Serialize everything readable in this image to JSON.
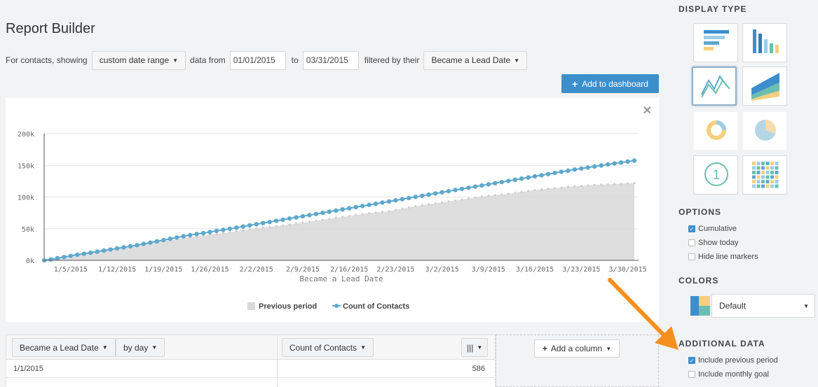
{
  "page_title": "Report Builder",
  "filter": {
    "prefix": "For contacts, showing",
    "range_label": "custom date range",
    "data_from": "data from",
    "start_date": "01/01/2015",
    "to": "to",
    "end_date": "03/31/2015",
    "filtered_by": "filtered by their",
    "property_label": "Became a Lead Date"
  },
  "add_dashboard_label": "Add to dashboard",
  "chart_data": {
    "type": "area",
    "xlabel": "Became a Lead Date",
    "ylim": [
      0,
      200000
    ],
    "y_ticks": [
      "0k",
      "50k",
      "100k",
      "150k",
      "200k"
    ],
    "x_ticks": [
      "1/5/2015",
      "1/12/2015",
      "1/19/2015",
      "1/26/2015",
      "2/2/2015",
      "2/9/2015",
      "2/16/2015",
      "2/23/2015",
      "3/2/2015",
      "3/9/2015",
      "3/16/2015",
      "3/23/2015",
      "3/30/2015"
    ],
    "x_range": [
      "2015-01-01",
      "2015-03-31"
    ],
    "legend": [
      "Previous period",
      "Count of Contacts"
    ],
    "legend_placement": "bottom-center",
    "grid": true,
    "colors": {
      "previous": "#d8d8d8",
      "count": "#5ea8cc"
    },
    "series": [
      {
        "name": "Count of Contacts",
        "values": [
          0,
          1500,
          3500,
          5200,
          7000,
          8800,
          10400,
          12000,
          13700,
          15400,
          17100,
          18800,
          20500,
          22300,
          24000,
          26000,
          28000,
          30000,
          32000,
          34000,
          36000,
          38000,
          39800,
          41500,
          43000,
          44800,
          46600,
          48200,
          49800,
          51600,
          53400,
          55200,
          57000,
          58800,
          60600,
          62400,
          64200,
          66000,
          67800,
          69600,
          71400,
          73200,
          75000,
          76800,
          78600,
          80400,
          82200,
          84000,
          85800,
          87600,
          89400,
          91200,
          93000,
          94800,
          96600,
          98400,
          100200,
          102000,
          103800,
          105600,
          107400,
          109200,
          111000,
          112800,
          114600,
          116400,
          118200,
          120000,
          121800,
          123600,
          125400,
          127200,
          129000,
          130800,
          132600,
          134400,
          136200,
          138000,
          139800,
          141600,
          143400,
          145000,
          146600,
          148200,
          149800,
          151400,
          153000,
          154500,
          156000,
          157500
        ]
      },
      {
        "name": "Previous period",
        "values": [
          0,
          2000,
          4300,
          6400,
          8300,
          10000,
          11800,
          13500,
          15200,
          16800,
          18400,
          20000,
          21500,
          23000,
          24500,
          26000,
          27500,
          29000,
          30500,
          32000,
          33500,
          35000,
          36500,
          38000,
          39500,
          41000,
          42000,
          43000,
          44500,
          46000,
          47500,
          49000,
          50500,
          52000,
          53000,
          54000,
          55000,
          56500,
          58000,
          59500,
          61000,
          62500,
          64000,
          65500,
          67000,
          68500,
          70000,
          71500,
          73000,
          74500,
          75500,
          76500,
          77500,
          79500,
          81500,
          83500,
          85500,
          87000,
          88500,
          90000,
          91500,
          93000,
          94500,
          96000,
          97500,
          99000,
          100500,
          102000,
          103000,
          104000,
          105000,
          106500,
          108000,
          109500,
          111000,
          112000,
          113000,
          114000,
          115000,
          116000,
          116800,
          117500,
          118200,
          118900,
          119500,
          120000,
          120500,
          121000,
          121500,
          122000
        ]
      }
    ]
  },
  "table": {
    "group_label": "Became a Lead Date",
    "interval_label": "by day",
    "metric_label": "Count of Contacts",
    "columns_icon": "|||",
    "add_column_label": "Add a column",
    "rows": [
      {
        "date": "1/1/2015",
        "value": "586"
      }
    ]
  },
  "sidebar": {
    "display_type_title": "DISPLAY TYPE",
    "chart_types": [
      "horizontal-bar-chart",
      "vertical-bar-chart",
      "line-chart",
      "stacked-area-chart",
      "donut-chart",
      "pie-chart",
      "single-number",
      "table-chart"
    ],
    "selected_chart_type": "line-chart",
    "options_title": "OPTIONS",
    "options": [
      {
        "label": "Cumulative",
        "checked": true
      },
      {
        "label": "Show today",
        "checked": false
      },
      {
        "label": "Hide line markers",
        "checked": false
      }
    ],
    "colors_title": "COLORS",
    "color_scheme": "Default",
    "additional_title": "ADDITIONAL DATA",
    "additional": [
      {
        "label": "Include previous period",
        "checked": true
      },
      {
        "label": "Include monthly goal",
        "checked": false
      }
    ]
  },
  "annotation_arrow_color": "#f5901e"
}
